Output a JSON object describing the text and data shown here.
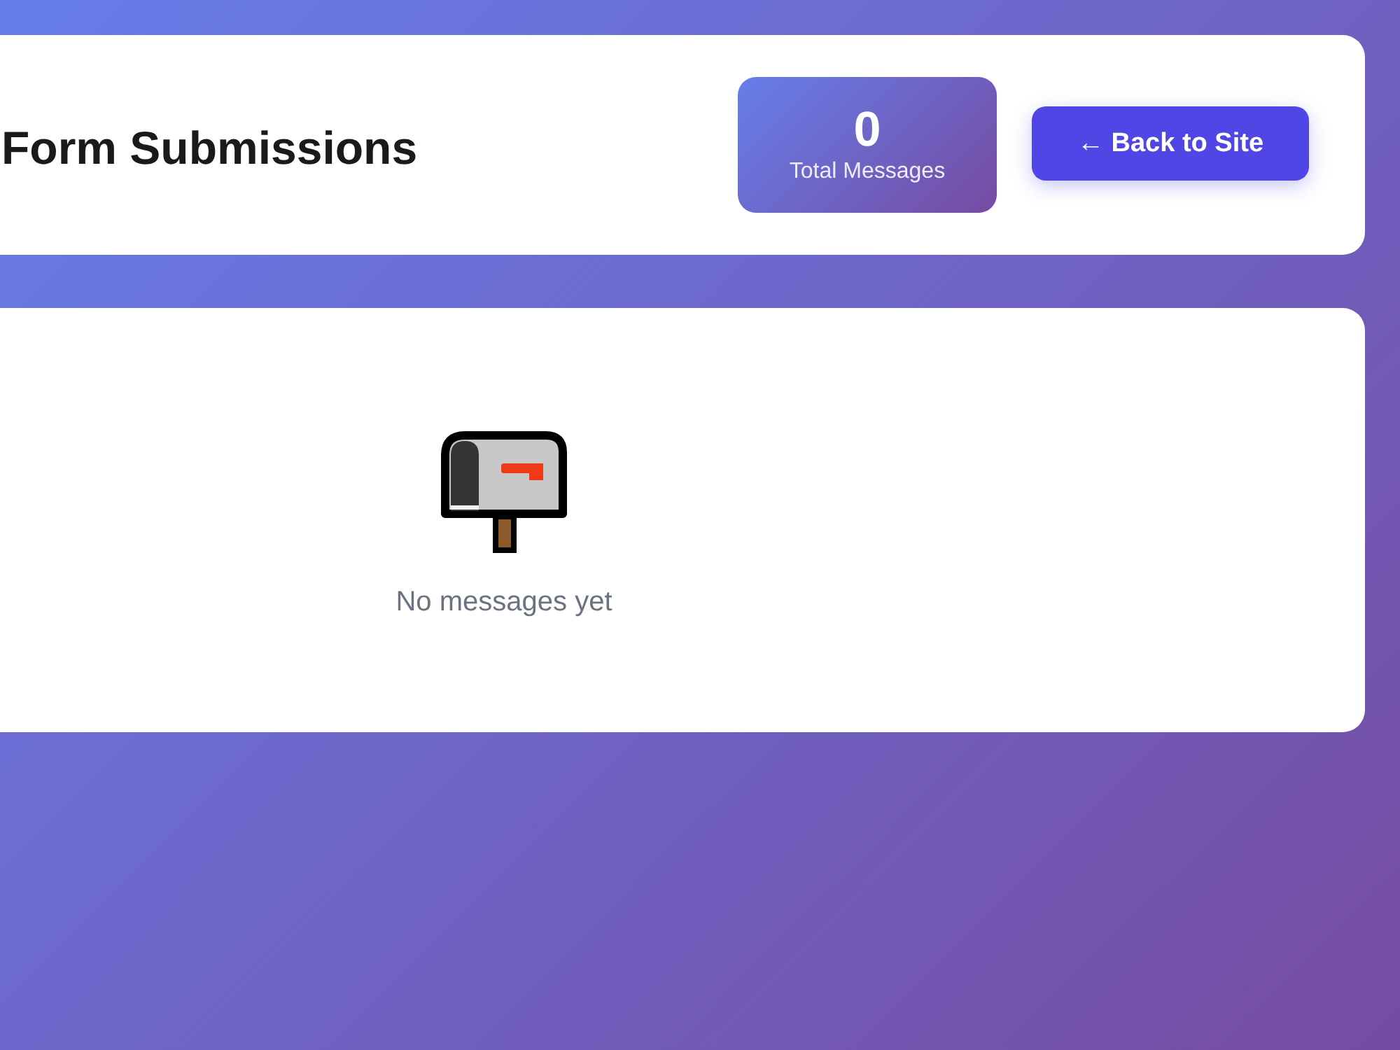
{
  "header": {
    "title": "Form Submissions",
    "stat": {
      "value": "0",
      "label": "Total Messages"
    },
    "back_button": {
      "label": "← Back to Site"
    }
  },
  "empty_state": {
    "text": "No messages yet"
  }
}
